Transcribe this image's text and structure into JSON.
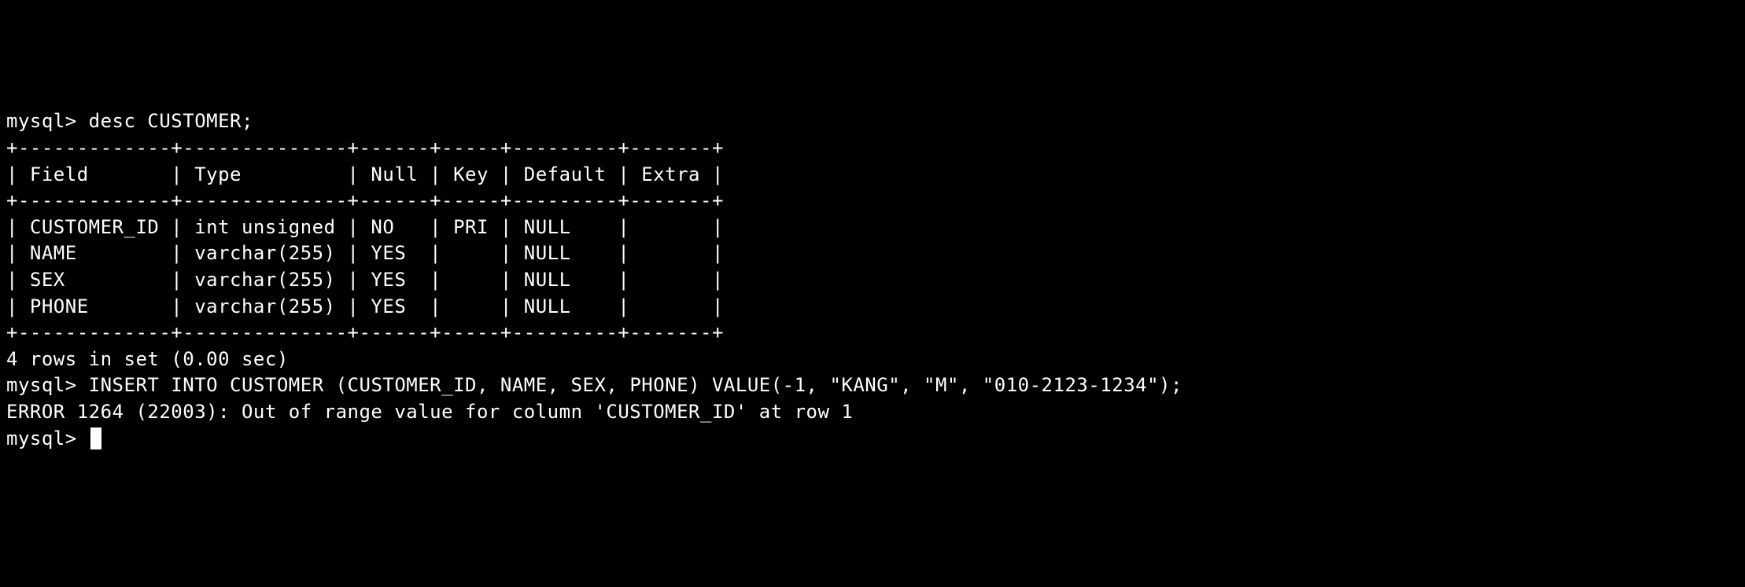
{
  "terminal": {
    "prompt1": "mysql> ",
    "command1": "desc CUSTOMER;",
    "table_border_top": "+-------------+--------------+------+-----+---------+-------+",
    "table_header": "| Field       | Type         | Null | Key | Default | Extra |",
    "table_border_mid": "+-------------+--------------+------+-----+---------+-------+",
    "table_row1": "| CUSTOMER_ID | int unsigned | NO   | PRI | NULL    |       |",
    "table_row2": "| NAME        | varchar(255) | YES  |     | NULL    |       |",
    "table_row3": "| SEX         | varchar(255) | YES  |     | NULL    |       |",
    "table_row4": "| PHONE       | varchar(255) | YES  |     | NULL    |       |",
    "table_border_bot": "+-------------+--------------+------+-----+---------+-------+",
    "result_summary": "4 rows in set (0.00 sec)",
    "blank": "",
    "prompt2": "mysql> ",
    "command2": "INSERT INTO CUSTOMER (CUSTOMER_ID, NAME, SEX, PHONE) VALUE(-1, \"KANG\", \"M\", \"010-2123-1234\");",
    "error_line": "ERROR 1264 (22003): Out of range value for column 'CUSTOMER_ID' at row 1",
    "prompt3": "mysql> "
  },
  "table_structure": {
    "columns": [
      "Field",
      "Type",
      "Null",
      "Key",
      "Default",
      "Extra"
    ],
    "rows": [
      {
        "Field": "CUSTOMER_ID",
        "Type": "int unsigned",
        "Null": "NO",
        "Key": "PRI",
        "Default": "NULL",
        "Extra": ""
      },
      {
        "Field": "NAME",
        "Type": "varchar(255)",
        "Null": "YES",
        "Key": "",
        "Default": "NULL",
        "Extra": ""
      },
      {
        "Field": "SEX",
        "Type": "varchar(255)",
        "Null": "YES",
        "Key": "",
        "Default": "NULL",
        "Extra": ""
      },
      {
        "Field": "PHONE",
        "Type": "varchar(255)",
        "Null": "YES",
        "Key": "",
        "Default": "NULL",
        "Extra": ""
      }
    ]
  }
}
